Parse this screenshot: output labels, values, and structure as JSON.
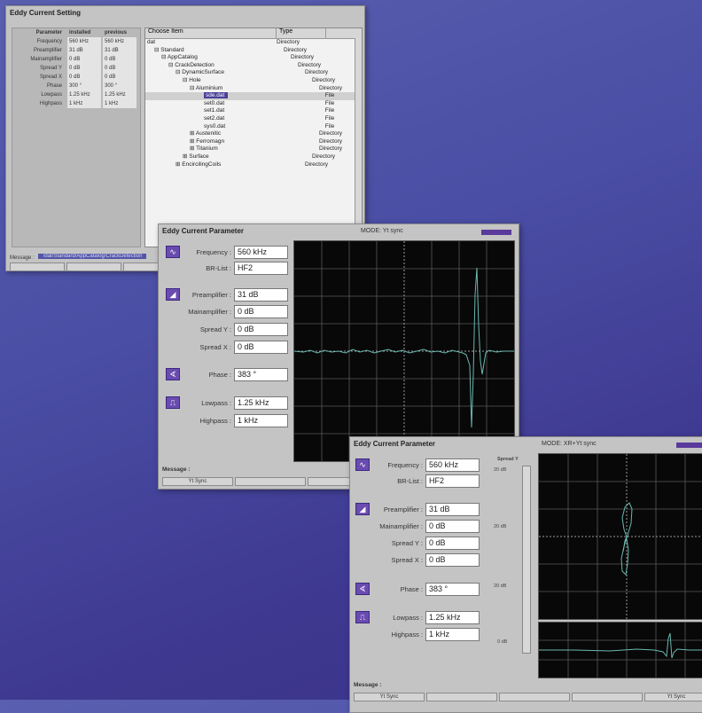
{
  "colors": {
    "accent": "#5a3a9c",
    "scope_bg": "#080808",
    "trace": "#6ab8b0",
    "background": "#4a4ea4"
  },
  "window1": {
    "title": "Eddy Current Setting",
    "param_headers": [
      "Parameter",
      "installed",
      "previous"
    ],
    "param_rows": [
      [
        "Frequency",
        "560 kHz",
        "560 kHz"
      ],
      [
        "Preamplifier",
        "31 dB",
        "31 dB"
      ],
      [
        "Mainamplifier",
        "0 dB",
        "0 dB"
      ],
      [
        "Spread Y",
        "0 dB",
        "0 dB"
      ],
      [
        "Spread X",
        "0 dB",
        "0 dB"
      ],
      [
        "Phase",
        "300 °",
        "300 °"
      ],
      [
        "Lowpass",
        "1.25 kHz",
        "1.25 kHz"
      ],
      [
        "Highpass",
        "1 kHz",
        "1 kHz"
      ]
    ],
    "tree_headers": [
      "Choose Item",
      "Type"
    ],
    "tree_rows": [
      {
        "name": "dat",
        "type": "Directory",
        "indent": 0,
        "prefix": ""
      },
      {
        "name": "Standard",
        "type": "Directory",
        "indent": 1,
        "prefix": "⊟"
      },
      {
        "name": "AppCatalog",
        "type": "Directory",
        "indent": 2,
        "prefix": "⊟"
      },
      {
        "name": "CrackDetection",
        "type": "Directory",
        "indent": 3,
        "prefix": "⊟"
      },
      {
        "name": "DynamicSurface",
        "type": "Directory",
        "indent": 4,
        "prefix": "⊟"
      },
      {
        "name": "Hole",
        "type": "Directory",
        "indent": 5,
        "prefix": "⊟"
      },
      {
        "name": "Aluminium",
        "type": "Directory",
        "indent": 6,
        "prefix": "⊟"
      },
      {
        "name": "sde.dat",
        "type": "File",
        "indent": 8,
        "prefix": "",
        "selected": true
      },
      {
        "name": "set0.dat",
        "type": "File",
        "indent": 8,
        "prefix": ""
      },
      {
        "name": "set1.dat",
        "type": "File",
        "indent": 8,
        "prefix": ""
      },
      {
        "name": "set2.dat",
        "type": "File",
        "indent": 8,
        "prefix": ""
      },
      {
        "name": "sys0.dat",
        "type": "File",
        "indent": 8,
        "prefix": ""
      },
      {
        "name": "Austenitic",
        "type": "Directory",
        "indent": 6,
        "prefix": "⊞"
      },
      {
        "name": "Ferromagn",
        "type": "Directory",
        "indent": 6,
        "prefix": "⊞"
      },
      {
        "name": "Titanium",
        "type": "Directory",
        "indent": 6,
        "prefix": "⊞"
      },
      {
        "name": "Surface",
        "type": "Directory",
        "indent": 5,
        "prefix": "⊞"
      },
      {
        "name": "EncircilingCoils",
        "type": "Directory",
        "indent": 4,
        "prefix": "⊞"
      }
    ],
    "message_label": "Message :",
    "message_value": "/dat/Standard/AppCatalog/CrackDetection",
    "buttons": [
      "",
      "",
      ""
    ]
  },
  "window2": {
    "title": "Eddy Current Parameter",
    "mode": "MODE:  Yt  sync",
    "params": {
      "frequency": {
        "label": "Frequency :",
        "value": "560 kHz"
      },
      "bplist": {
        "label": "BR-List :",
        "value": "HF2"
      },
      "preamp": {
        "label": "Preamplifier :",
        "value": "31 dB"
      },
      "mainamp": {
        "label": "Mainamplifier :",
        "value": "0 dB"
      },
      "spready": {
        "label": "Spread Y :",
        "value": "0 dB"
      },
      "spreadx": {
        "label": "Spread X :",
        "value": "0 dB"
      },
      "phase": {
        "label": "Phase :",
        "value": "383 °"
      },
      "lowpass": {
        "label": "Lowpass :",
        "value": "1.25 kHz"
      },
      "highpass": {
        "label": "Highpass :",
        "value": "1 kHz"
      }
    },
    "message_label": "Message :",
    "buttons": [
      "Yt Sync",
      "",
      ""
    ]
  },
  "window3": {
    "title": "Eddy Current Parameter",
    "mode": "MODE:  XR+Yt  sync",
    "spread_label": "Spread Y",
    "axis_labels": [
      "20 dB",
      "20 dB",
      "20 dB",
      "0 dB"
    ],
    "params": {
      "frequency": {
        "label": "Frequency :",
        "value": "560 kHz"
      },
      "bplist": {
        "label": "BR-List :",
        "value": "HF2"
      },
      "preamp": {
        "label": "Preamplifier :",
        "value": "31 dB"
      },
      "mainamp": {
        "label": "Mainamplifier :",
        "value": "0 dB"
      },
      "spready": {
        "label": "Spread Y :",
        "value": "0 dB"
      },
      "spreadx": {
        "label": "Spread X :",
        "value": "0 dB"
      },
      "phase": {
        "label": "Phase :",
        "value": "383 °"
      },
      "lowpass": {
        "label": "Lowpass :",
        "value": "1.25 kHz"
      },
      "highpass": {
        "label": "Highpass :",
        "value": "1 kHz"
      }
    },
    "message_label": "Message :",
    "buttons": [
      "Yt Sync",
      "",
      "",
      "",
      "Yt Sync"
    ]
  }
}
